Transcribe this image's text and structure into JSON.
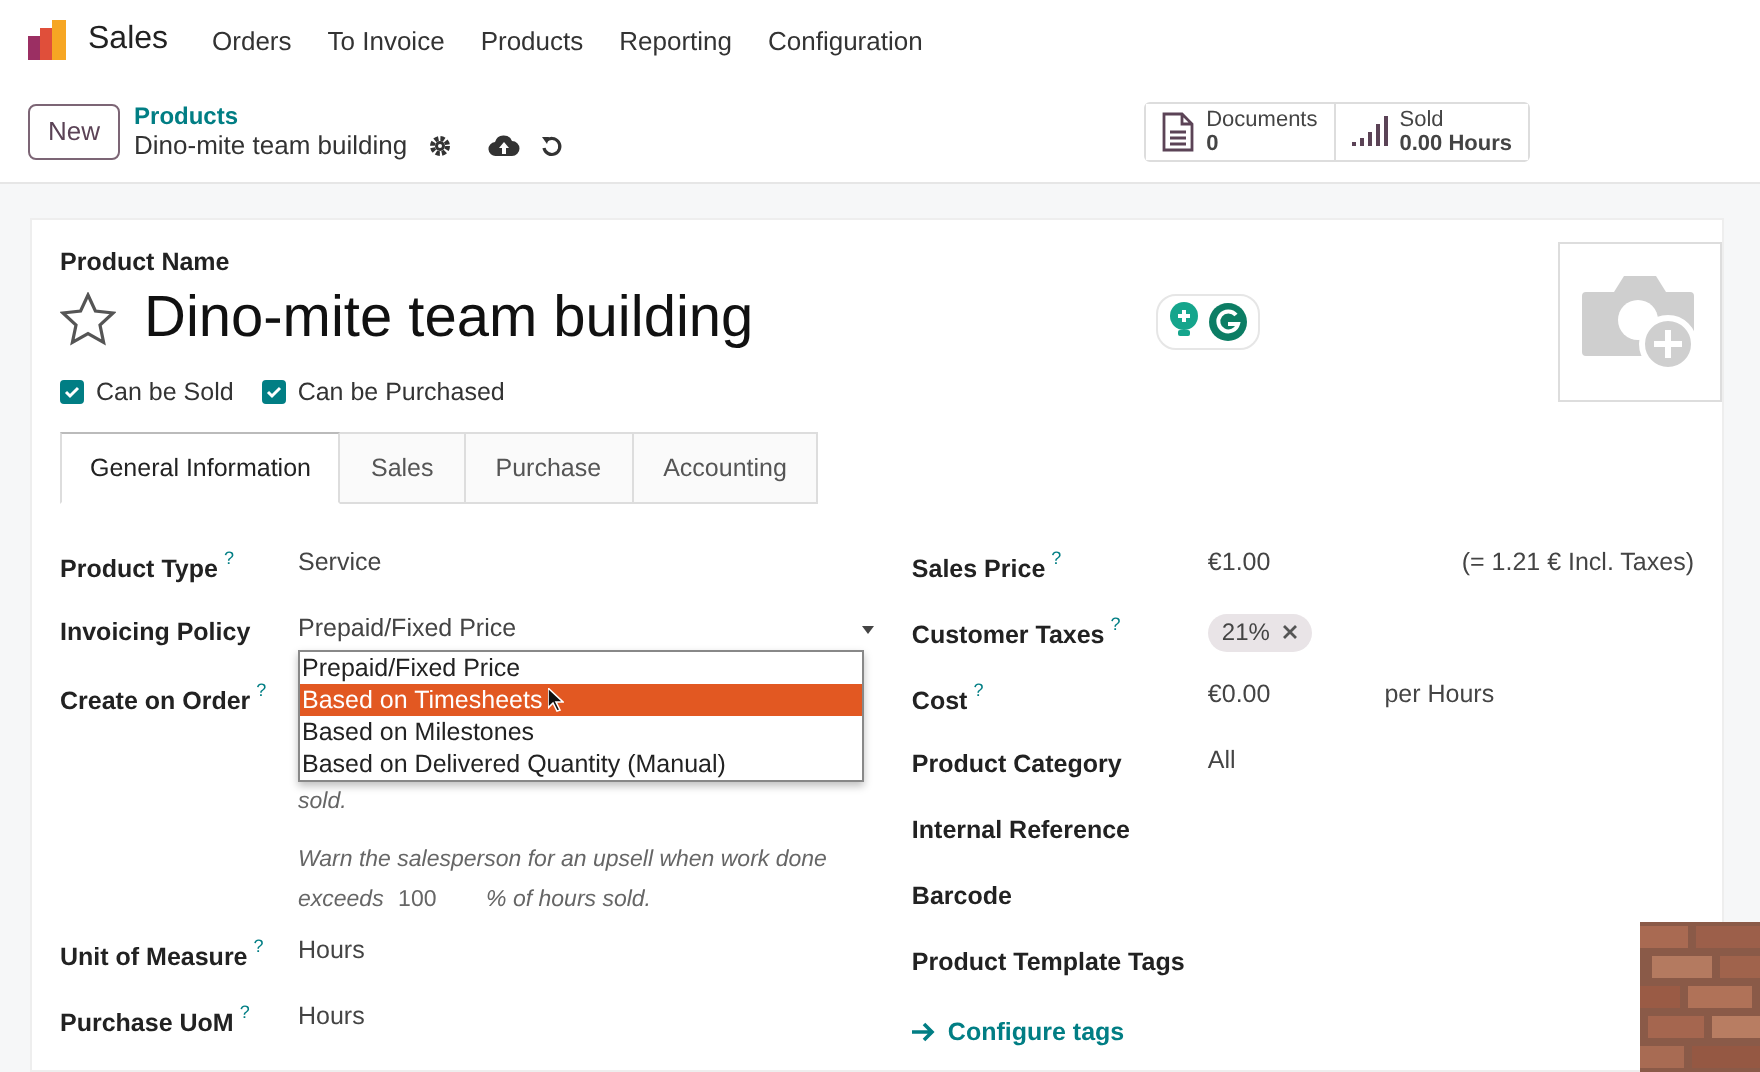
{
  "nav": {
    "app": "Sales",
    "menu": [
      "Orders",
      "To Invoice",
      "Products",
      "Reporting",
      "Configuration"
    ]
  },
  "control_panel": {
    "new_button": "New",
    "breadcrumb": "Products",
    "record": "Dino-mite team building",
    "stats": [
      {
        "kind": "documents",
        "label": "Documents",
        "value": "0"
      },
      {
        "kind": "sold",
        "label": "Sold",
        "value": "0.00 Hours"
      }
    ]
  },
  "form": {
    "name_label": "Product Name",
    "name": "Dino-mite team building",
    "favorite": false,
    "checkboxes": [
      {
        "label": "Can be Sold",
        "checked": true
      },
      {
        "label": "Can be Purchased",
        "checked": true
      }
    ],
    "tabs": [
      {
        "label": "General Information",
        "selected": true
      },
      {
        "label": "Sales",
        "selected": false
      },
      {
        "label": "Purchase",
        "selected": false
      },
      {
        "label": "Accounting",
        "selected": false
      }
    ],
    "left": [
      {
        "kind": "text",
        "label": "Product Type",
        "help": "?",
        "value": "Service"
      },
      {
        "kind": "select",
        "label": "Invoicing Policy",
        "value": "Prepaid/Fixed Price",
        "options": [
          {
            "label": "Prepaid/Fixed Price",
            "highlighted": false
          },
          {
            "label": "Based on Timesheets",
            "highlighted": true
          },
          {
            "label": "Based on Milestones",
            "highlighted": false
          },
          {
            "label": "Based on Delivered Quantity (Manual)",
            "highlighted": false
          }
        ]
      },
      {
        "kind": "note",
        "label": "Create on Order",
        "help": "?",
        "note": "sold.",
        "warn_before": "Warn the salesperson for an upsell when work done exceeds",
        "warn_value": "100",
        "warn_after": "% of hours sold."
      },
      {
        "kind": "text",
        "label": "Unit of Measure",
        "help": "?",
        "value": "Hours"
      },
      {
        "kind": "text",
        "label": "Purchase UoM",
        "help": "?",
        "value": "Hours"
      }
    ],
    "right": [
      {
        "kind": "price",
        "label": "Sales Price",
        "help": "?",
        "value": "€1.00",
        "extra": "(= 1.21 € Incl. Taxes)"
      },
      {
        "kind": "tags",
        "label": "Customer Taxes",
        "help": "?",
        "tags": [
          "21%"
        ]
      },
      {
        "kind": "cost",
        "label": "Cost",
        "help": "?",
        "value": "€0.00",
        "extra": "per Hours"
      },
      {
        "kind": "text",
        "label": "Product Category",
        "value": "All"
      },
      {
        "kind": "text",
        "label": "Internal Reference"
      },
      {
        "kind": "text",
        "label": "Barcode"
      },
      {
        "kind": "text",
        "label": "Product Template Tags"
      }
    ],
    "configure_link": "Configure tags"
  }
}
